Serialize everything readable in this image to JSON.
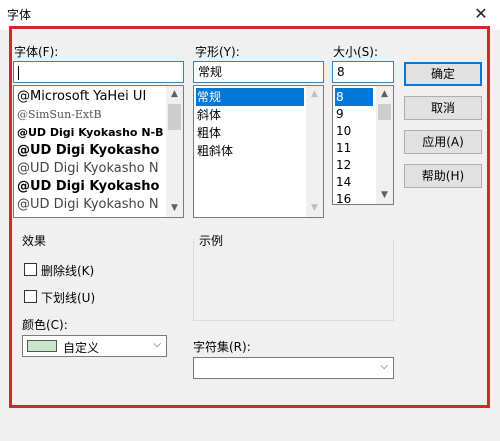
{
  "window": {
    "title": "字体",
    "close_glyph": "✕"
  },
  "font": {
    "label": "字体(F):",
    "value": "",
    "items": [
      "@Microsoft YaHei UI",
      "@SimSun-ExtB",
      "@UD Digi Kyokasho N-B",
      "@UD Digi Kyokasho N",
      "@UD Digi Kyokasho N",
      "@UD Digi Kyokasho N",
      "@UD Digi Kyokasho N"
    ]
  },
  "style": {
    "label": "字形(Y):",
    "value": "常规",
    "items": [
      "常规",
      "斜体",
      "粗体",
      "粗斜体"
    ],
    "selected_index": 0
  },
  "size": {
    "label": "大小(S):",
    "value": "8",
    "items": [
      "8",
      "9",
      "10",
      "11",
      "12",
      "14",
      "16"
    ],
    "selected_index": 0
  },
  "buttons": {
    "ok": "确定",
    "cancel": "取消",
    "apply": "应用(A)",
    "help": "帮助(H)"
  },
  "effects": {
    "label": "效果",
    "strikeout": "删除线(K)",
    "underline": "下划线(U)",
    "strikeout_checked": false,
    "underline_checked": false,
    "color_label": "颜色(C):",
    "color_value": "自定义",
    "color_swatch": "#c8e6c9"
  },
  "sample": {
    "label": "示例"
  },
  "charset": {
    "label": "字符集(R):",
    "value": ""
  },
  "colors": {
    "accent": "#0078d7",
    "highlight_frame": "#d7262a"
  }
}
